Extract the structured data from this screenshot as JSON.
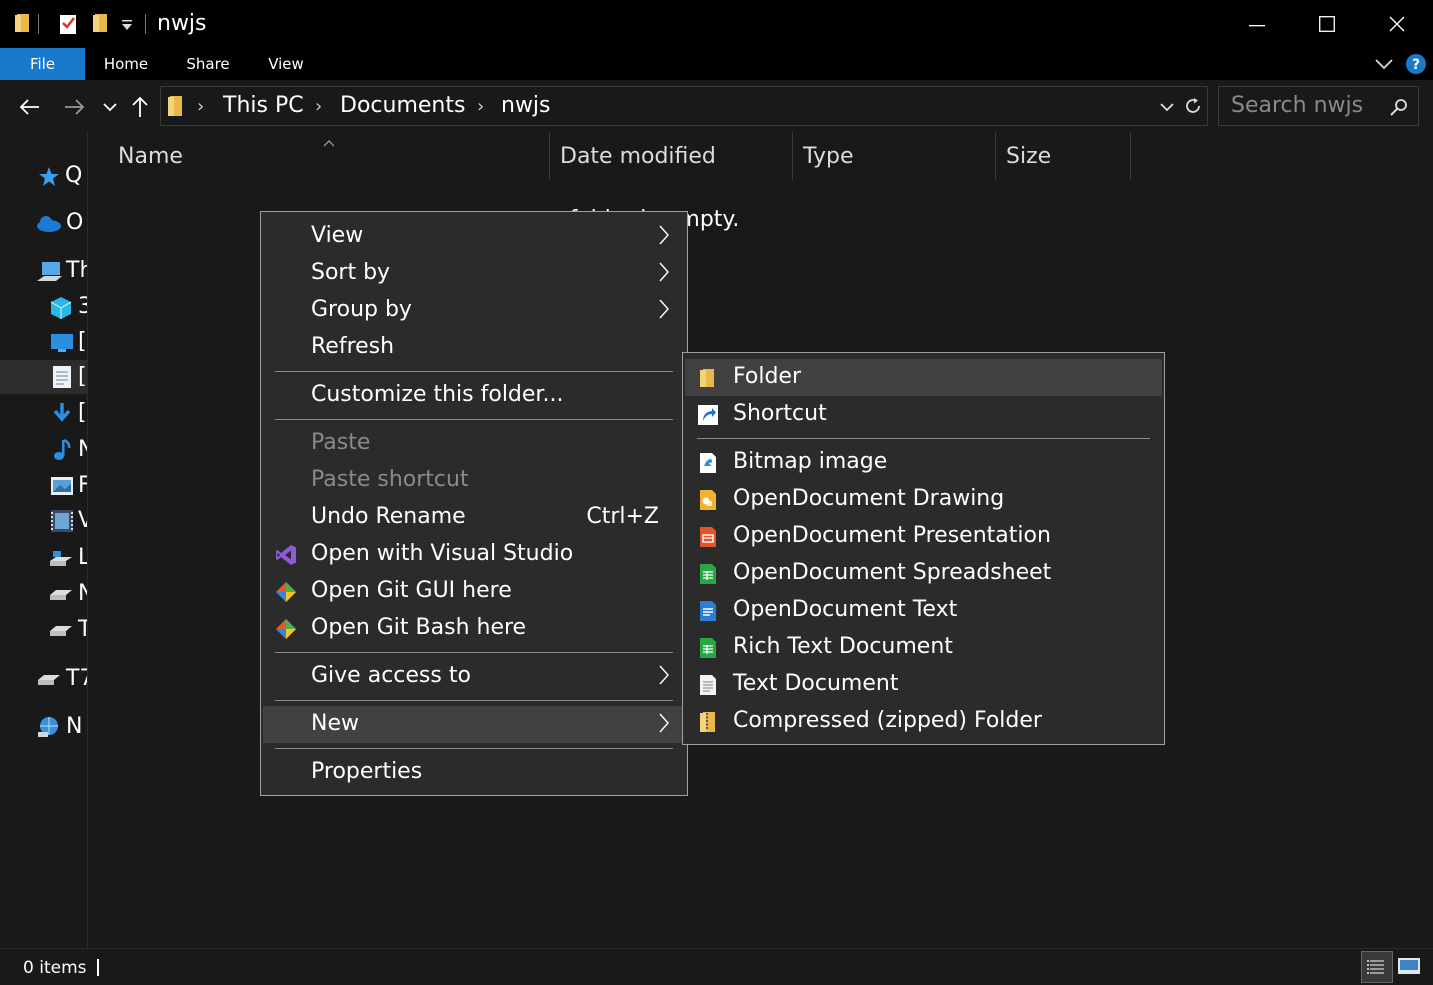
{
  "window": {
    "title": "nwjs",
    "colors": {
      "ribbon_file_tab": "#1979ca",
      "background": "#191919",
      "menu_bg": "#2b2b2b"
    }
  },
  "ribbon": {
    "tabs": [
      "File",
      "Home",
      "Share",
      "View"
    ]
  },
  "address": {
    "breadcrumbs": [
      "This PC",
      "Documents",
      "nwjs"
    ],
    "search_placeholder": "Search nwjs"
  },
  "navpane": {
    "items": [
      {
        "label": "Q",
        "icon": "quick-access-star-icon"
      },
      {
        "label": "O",
        "icon": "onedrive-cloud-icon"
      },
      {
        "label": "Th",
        "icon": "this-pc-icon"
      },
      {
        "label": "3",
        "icon": "3d-objects-icon"
      },
      {
        "label": "[",
        "icon": "desktop-icon"
      },
      {
        "label": "[",
        "icon": "documents-icon"
      },
      {
        "label": "[",
        "icon": "downloads-icon"
      },
      {
        "label": "N",
        "icon": "music-icon"
      },
      {
        "label": "F",
        "icon": "pictures-icon"
      },
      {
        "label": "V",
        "icon": "videos-icon"
      },
      {
        "label": "L",
        "icon": "local-disk-icon"
      },
      {
        "label": "N",
        "icon": "drive-icon"
      },
      {
        "label": "T",
        "icon": "drive-icon"
      },
      {
        "label": "T7",
        "icon": "drive-icon"
      },
      {
        "label": "N",
        "icon": "network-icon"
      }
    ]
  },
  "filepane": {
    "columns": [
      "Name",
      "Date modified",
      "Type",
      "Size"
    ],
    "empty_message": "s folder is empty."
  },
  "context_menu": {
    "items": [
      {
        "label": "View",
        "submenu": true
      },
      {
        "label": "Sort by",
        "submenu": true
      },
      {
        "label": "Group by",
        "submenu": true
      },
      {
        "label": "Refresh"
      },
      {
        "label": "Customize this folder..."
      },
      {
        "label": "Paste",
        "disabled": true
      },
      {
        "label": "Paste shortcut",
        "disabled": true
      },
      {
        "label": "Undo Rename",
        "accel": "Ctrl+Z"
      },
      {
        "label": "Open with Visual Studio",
        "icon": "visual-studio-icon"
      },
      {
        "label": "Open Git GUI here",
        "icon": "git-icon"
      },
      {
        "label": "Open Git Bash here",
        "icon": "git-icon"
      },
      {
        "label": "Give access to",
        "submenu": true
      },
      {
        "label": "New",
        "submenu": true,
        "highlighted": true
      },
      {
        "label": "Properties"
      }
    ]
  },
  "new_submenu": {
    "items": [
      {
        "label": "Folder",
        "icon": "folder-icon",
        "highlighted": true
      },
      {
        "label": "Shortcut",
        "icon": "shortcut-icon"
      },
      {
        "label": "Bitmap image",
        "icon": "bitmap-icon"
      },
      {
        "label": "OpenDocument Drawing",
        "icon": "od-drawing-icon"
      },
      {
        "label": "OpenDocument Presentation",
        "icon": "od-presentation-icon"
      },
      {
        "label": "OpenDocument Spreadsheet",
        "icon": "od-spreadsheet-icon"
      },
      {
        "label": "OpenDocument Text",
        "icon": "od-text-icon"
      },
      {
        "label": "Rich Text Document",
        "icon": "rich-text-icon"
      },
      {
        "label": "Text Document",
        "icon": "text-document-icon"
      },
      {
        "label": "Compressed (zipped) Folder",
        "icon": "zip-folder-icon"
      }
    ]
  },
  "status": {
    "item_count": "0 items"
  }
}
